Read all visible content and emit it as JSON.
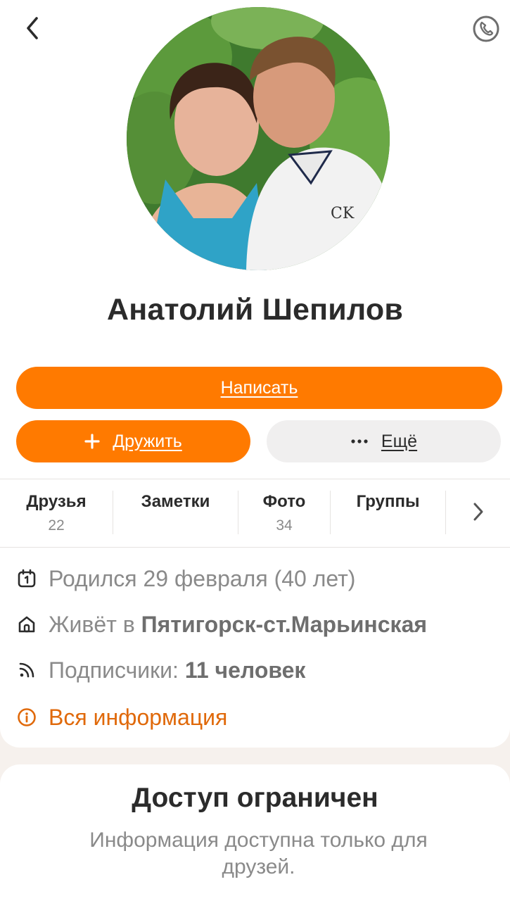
{
  "profile": {
    "name": "Анатолий Шепилов"
  },
  "actions": {
    "write_label": "Написать",
    "friend_label": "Дружить",
    "more_label": "Ещё"
  },
  "tabs": [
    {
      "label": "Друзья",
      "count": "22"
    },
    {
      "label": "Заметки",
      "count": ""
    },
    {
      "label": "Фото",
      "count": "34"
    },
    {
      "label": "Группы",
      "count": ""
    }
  ],
  "info": {
    "birthday": "Родился 29 февраля (40 лет)",
    "lives_prefix": "Живёт в",
    "lives_city": "Пятигорск-ст.Марьинская",
    "followers_prefix": "Подписчики:",
    "followers_value": "11 человек",
    "all_info_link": "Вся информация"
  },
  "restricted": {
    "title": "Доступ ограничен",
    "text": "Информация доступна только для друзей."
  },
  "icons": {
    "back": "chevron-left-icon",
    "call": "phone-icon",
    "plus": "plus-icon",
    "more": "ellipsis-icon",
    "tabs_next": "chevron-right-icon",
    "birthday": "calendar-icon",
    "home": "home-icon",
    "followers": "rss-icon",
    "info": "info-icon"
  },
  "colors": {
    "accent": "#ff7a00",
    "link": "#e0690a",
    "page_bg": "#f6f1ed"
  }
}
